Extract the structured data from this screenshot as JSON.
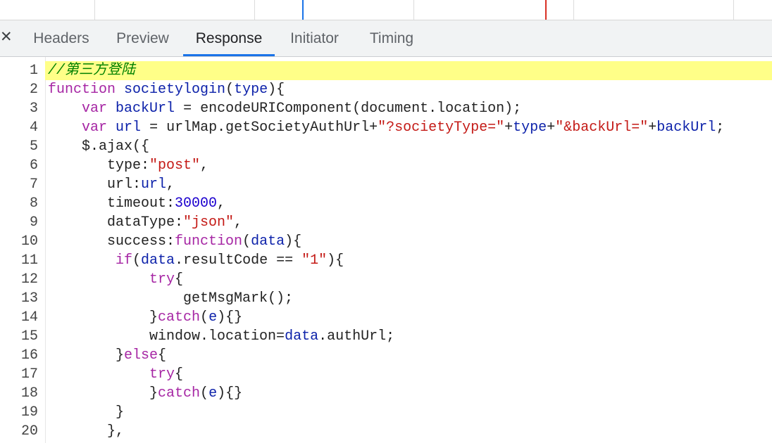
{
  "header": {
    "close_icon": "close-icon",
    "tabs": [
      {
        "label": "Headers",
        "active": false
      },
      {
        "label": "Preview",
        "active": false
      },
      {
        "label": "Response",
        "active": true
      },
      {
        "label": "Initiator",
        "active": false
      },
      {
        "label": "Timing",
        "active": false
      }
    ]
  },
  "colors": {
    "keyword": "#a626a4",
    "identifier": "#0d22aa",
    "string": "#c41a16",
    "number": "#1c00cf",
    "plain": "#222222",
    "comment": "#008000",
    "highlight": "#ffff88",
    "active_tab_underline": "#1a73e8",
    "timeline_blue": "#1a73e8",
    "timeline_red": "#d93025"
  },
  "code": {
    "lines": [
      [
        [
          "c",
          "//第三方登陆"
        ]
      ],
      [
        [
          "k",
          "function"
        ],
        [
          "p",
          " "
        ],
        [
          "i",
          "societylogin"
        ],
        [
          "p",
          "("
        ],
        [
          "i",
          "type"
        ],
        [
          "p",
          "){"
        ]
      ],
      [
        [
          "p",
          "    "
        ],
        [
          "k",
          "var"
        ],
        [
          "p",
          " "
        ],
        [
          "i",
          "backUrl"
        ],
        [
          "p",
          " = encodeURIComponent(document.location);"
        ]
      ],
      [
        [
          "p",
          "    "
        ],
        [
          "k",
          "var"
        ],
        [
          "p",
          " "
        ],
        [
          "i",
          "url"
        ],
        [
          "p",
          " = urlMap.getSocietyAuthUrl+"
        ],
        [
          "s",
          "\"?societyType=\""
        ],
        [
          "p",
          "+"
        ],
        [
          "i",
          "type"
        ],
        [
          "p",
          "+"
        ],
        [
          "s",
          "\"&backUrl=\""
        ],
        [
          "p",
          "+"
        ],
        [
          "i",
          "backUrl"
        ],
        [
          "p",
          ";"
        ]
      ],
      [
        [
          "p",
          "    $.ajax({"
        ]
      ],
      [
        [
          "p",
          "       type:"
        ],
        [
          "s",
          "\"post\""
        ],
        [
          "p",
          ","
        ]
      ],
      [
        [
          "p",
          "       url:"
        ],
        [
          "i",
          "url"
        ],
        [
          "p",
          ","
        ]
      ],
      [
        [
          "p",
          "       timeout:"
        ],
        [
          "n",
          "30000"
        ],
        [
          "p",
          ","
        ]
      ],
      [
        [
          "p",
          "       dataType:"
        ],
        [
          "s",
          "\"json\""
        ],
        [
          "p",
          ","
        ]
      ],
      [
        [
          "p",
          "       success:"
        ],
        [
          "k",
          "function"
        ],
        [
          "p",
          "("
        ],
        [
          "i",
          "data"
        ],
        [
          "p",
          "){"
        ]
      ],
      [
        [
          "p",
          "        "
        ],
        [
          "k",
          "if"
        ],
        [
          "p",
          "("
        ],
        [
          "i",
          "data"
        ],
        [
          "p",
          ".resultCode == "
        ],
        [
          "s",
          "\"1\""
        ],
        [
          "p",
          "){"
        ]
      ],
      [
        [
          "p",
          "            "
        ],
        [
          "k",
          "try"
        ],
        [
          "p",
          "{"
        ]
      ],
      [
        [
          "p",
          "                getMsgMark();"
        ]
      ],
      [
        [
          "p",
          "            }"
        ],
        [
          "k",
          "catch"
        ],
        [
          "p",
          "("
        ],
        [
          "i",
          "e"
        ],
        [
          "p",
          "){}"
        ]
      ],
      [
        [
          "p",
          "            window.location="
        ],
        [
          "i",
          "data"
        ],
        [
          "p",
          ".authUrl;"
        ]
      ],
      [
        [
          "p",
          "        }"
        ],
        [
          "k",
          "else"
        ],
        [
          "p",
          "{"
        ]
      ],
      [
        [
          "p",
          "            "
        ],
        [
          "k",
          "try"
        ],
        [
          "p",
          "{"
        ]
      ],
      [
        [
          "p",
          "            }"
        ],
        [
          "k",
          "catch"
        ],
        [
          "p",
          "("
        ],
        [
          "i",
          "e"
        ],
        [
          "p",
          "){}"
        ]
      ],
      [
        [
          "p",
          "        }"
        ]
      ],
      [
        [
          "p",
          "       },"
        ]
      ]
    ]
  }
}
